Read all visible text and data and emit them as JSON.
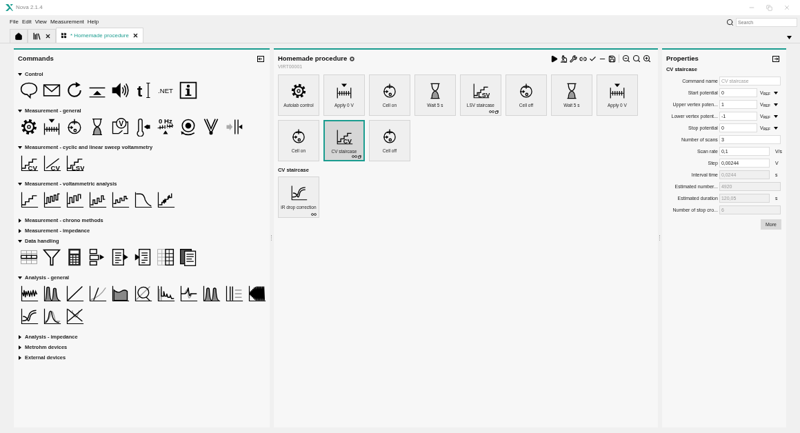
{
  "window": {
    "title": "Nova 2.1.4"
  },
  "menu": [
    "File",
    "Edit",
    "View",
    "Measurement",
    "Help"
  ],
  "search": {
    "placeholder": "Search"
  },
  "tabs": [
    {
      "kind": "home",
      "selected": false,
      "closable": false
    },
    {
      "kind": "library",
      "selected": false,
      "closable": true
    },
    {
      "kind": "procedure",
      "label": "* Homemade procedure",
      "selected": true,
      "closable": true
    }
  ],
  "commands": {
    "title": "Commands",
    "sections": [
      {
        "title": "Control",
        "expanded": true,
        "icons": [
          {
            "kind": "speech-bubble"
          },
          {
            "kind": "envelope"
          },
          {
            "kind": "loop-arrow"
          },
          {
            "kind": "level-line"
          },
          {
            "kind": "speaker"
          },
          {
            "kind": "text-cursor",
            "label": "t"
          },
          {
            "kind": "text-label",
            "label": ".NET"
          },
          {
            "kind": "info"
          }
        ]
      },
      {
        "title": "Measurement - general",
        "expanded": true,
        "icons": [
          {
            "kind": "gear"
          },
          {
            "kind": "tick-ruler"
          },
          {
            "kind": "cell"
          },
          {
            "kind": "hourglass"
          },
          {
            "kind": "voltmeter",
            "label": "V"
          },
          {
            "kind": "thermometer"
          },
          {
            "kind": "frequency-ruler",
            "label": "0 Hz"
          },
          {
            "kind": "disk"
          },
          {
            "kind": "v-shape"
          },
          {
            "kind": "bars-arrow"
          }
        ]
      },
      {
        "title": "Measurement - cyclic and linear sweep voltammetry",
        "expanded": true,
        "icons": [
          {
            "kind": "step-plot",
            "label": "CV"
          },
          {
            "kind": "line-plot",
            "label": "CV"
          },
          {
            "kind": "step-plot",
            "label": "LSV"
          }
        ]
      },
      {
        "title": "Measurement - voltammetric analysis",
        "expanded": true,
        "icons": [
          {
            "kind": "step-plot"
          },
          {
            "kind": "pulse-plot"
          },
          {
            "kind": "square-wave-plot"
          },
          {
            "kind": "stair-pulse-plot"
          },
          {
            "kind": "small-pulse-plot"
          },
          {
            "kind": "decay-plot"
          },
          {
            "kind": "noisy-step-plot"
          }
        ]
      },
      {
        "title": "Measurement - chrono methods",
        "expanded": false
      },
      {
        "title": "Measurement - impedance",
        "expanded": false
      },
      {
        "title": "Data handling",
        "expanded": true,
        "icons": [
          {
            "kind": "table"
          },
          {
            "kind": "funnel"
          },
          {
            "kind": "calculator"
          },
          {
            "kind": "blocks-arrow"
          },
          {
            "kind": "document-arrow-out"
          },
          {
            "kind": "document-arrow-in"
          },
          {
            "kind": "grid"
          },
          {
            "kind": "documents"
          }
        ]
      },
      {
        "title": "Analysis - general",
        "expanded": true,
        "icons": [
          {
            "kind": "noise-plot"
          },
          {
            "kind": "peaks-plot"
          },
          {
            "kind": "diagonal-plot"
          },
          {
            "kind": "steep-line-plot"
          },
          {
            "kind": "filled-plot"
          },
          {
            "kind": "magnifier-plot"
          },
          {
            "kind": "decay-spikes-plot"
          },
          {
            "kind": "wave-plot"
          },
          {
            "kind": "twin-peaks-plot"
          },
          {
            "kind": "vertical-lines-plot"
          },
          {
            "kind": "dense-wave-plot"
          },
          {
            "kind": "loop-plot"
          },
          {
            "kind": "peak-plot"
          },
          {
            "kind": "cross-plot"
          }
        ]
      },
      {
        "title": "Analysis - impedance",
        "expanded": false
      },
      {
        "title": "Metrohm devices",
        "expanded": false
      },
      {
        "title": "External devices",
        "expanded": false
      }
    ]
  },
  "procedure": {
    "title": "Homemade procedure",
    "subtitle": "VIRT00001",
    "tiles": [
      {
        "label": "Autolab control",
        "kind": "gear",
        "selected": false,
        "linked": false,
        "copied": false
      },
      {
        "label": "Apply 0 V",
        "kind": "tick-ruler",
        "selected": false,
        "linked": false,
        "copied": false
      },
      {
        "label": "Cell on",
        "kind": "cell",
        "selected": false,
        "linked": false,
        "copied": false
      },
      {
        "label": "Wait 5 s",
        "kind": "hourglass",
        "selected": false,
        "linked": false,
        "copied": false
      },
      {
        "label": "LSV staircase",
        "kind": "step-plot",
        "icon_label": "LSV",
        "selected": false,
        "linked": true,
        "copied": true
      },
      {
        "label": "Cell off",
        "kind": "cell",
        "selected": false,
        "linked": false,
        "copied": false
      },
      {
        "label": "Wait 5 s",
        "kind": "hourglass",
        "selected": false,
        "linked": false,
        "copied": false
      },
      {
        "label": "Apply 0 V",
        "kind": "tick-ruler",
        "selected": false,
        "linked": false,
        "copied": false
      },
      {
        "label": "Cell on",
        "kind": "cell",
        "selected": false,
        "linked": false,
        "copied": false
      },
      {
        "label": "CV staircase",
        "kind": "step-plot",
        "icon_label": "CV",
        "selected": true,
        "linked": true,
        "copied": true
      },
      {
        "label": "Cell off",
        "kind": "cell",
        "selected": false,
        "linked": false,
        "copied": false
      }
    ],
    "sub_title": "CV staircase",
    "sub_tiles": [
      {
        "label": "iR drop correction",
        "kind": "loop-plot",
        "selected": false,
        "linked": true,
        "copied": false
      }
    ]
  },
  "properties": {
    "title": "Properties",
    "subtitle": "CV staircase",
    "rows": [
      {
        "label": "Command name",
        "placeholder": "CV staircase",
        "disabled": false
      },
      {
        "label": "Start potential",
        "value": "0",
        "unit": "V$_{REF}$",
        "dropdown": true,
        "disabled": false
      },
      {
        "label": "Upper vertex poten...",
        "value": "1",
        "unit": "V$_{REF}$",
        "dropdown": true,
        "disabled": false
      },
      {
        "label": "Lower vertex potent...",
        "value": "-1",
        "unit": "V$_{REF}$",
        "dropdown": true,
        "disabled": false
      },
      {
        "label": "Stop potential",
        "value": "0",
        "unit": "V$_{REF}$",
        "dropdown": true,
        "disabled": false
      },
      {
        "label": "Number of scans",
        "value": "3",
        "disabled": false
      },
      {
        "label": "Scan rate",
        "value": "0,1",
        "unit": "V/s",
        "disabled": false
      },
      {
        "label": "Step",
        "value": "0,00244",
        "unit": "V",
        "disabled": false
      },
      {
        "label": "Interval time",
        "value": "0,0244",
        "unit": "s",
        "disabled": true
      },
      {
        "label": "Estimated number...",
        "value": "4920",
        "disabled": true
      },
      {
        "label": "Estimated duration",
        "value": "120,05",
        "unit": "s",
        "disabled": true
      },
      {
        "label": "Number of stop cro...",
        "value": "6",
        "disabled": true
      }
    ],
    "button": "More"
  }
}
